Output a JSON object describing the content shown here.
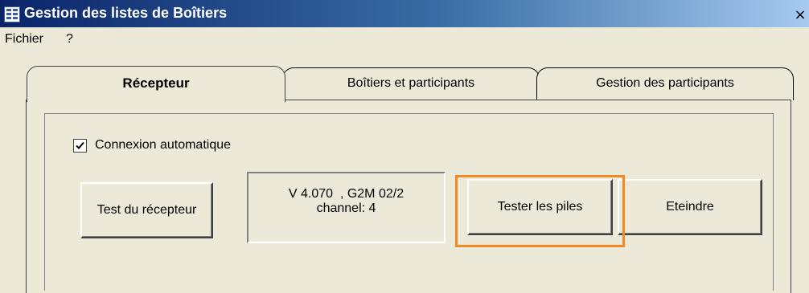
{
  "window": {
    "title": "Gestion des listes de Boîtiers",
    "close_symbol": "×",
    "icon": "app-list-icon"
  },
  "menu": {
    "items": [
      {
        "label": "Fichier"
      },
      {
        "label": "?"
      }
    ]
  },
  "tabs": [
    {
      "label": "Récepteur",
      "active": true
    },
    {
      "label": "Boîtiers et participants",
      "active": false
    },
    {
      "label": "Gestion des participants",
      "active": false
    }
  ],
  "panel": {
    "auto_connect": {
      "label": "Connexion automatique",
      "checked": true
    },
    "test_receiver_button": "Test du récepteur",
    "status": {
      "line1": "V 4.070  , G2M 02/2",
      "line2": "channel: 4"
    },
    "test_batteries_button": "Tester les piles",
    "turn_off_button": "Eteindre"
  },
  "colors": {
    "window_bg": "#ece9d8",
    "titlebar_start": "#0a246a",
    "titlebar_end": "#a6caf0",
    "highlight": "#f08a24"
  }
}
